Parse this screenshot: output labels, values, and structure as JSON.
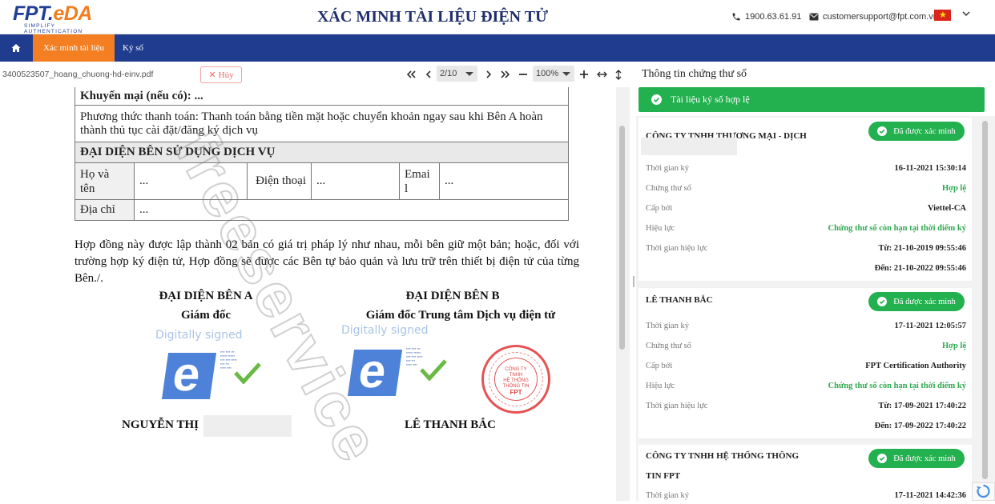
{
  "header": {
    "logo_text_a": "FPT.",
    "logo_text_b": "eDA",
    "logo_sub": "SIMPLIFY AUTHENTICATION",
    "title": "XÁC MINH TÀI LIỆU ĐIỆN TỬ",
    "phone": "1900.63.61.91",
    "email": "customersupport@fpt.com.vn"
  },
  "nav": {
    "tabs": [
      {
        "label": "Xác minh tài liệu"
      },
      {
        "label": "Ký số"
      }
    ]
  },
  "toolbar": {
    "filename": "3400523507_hoang_chuong-hd-einv.pdf",
    "cancel_label": "Hủy",
    "page": "2/10",
    "zoom": "100%"
  },
  "document": {
    "promo": "Khuyến mại (nếu có): ...",
    "payment": "Phương thức thanh toán: Thanh toán bằng tiền mặt hoặc chuyển khoản ngay sau khi Bên A hoàn thành thủ tục cài đặt/đăng ký dịch vụ",
    "rep_header": "ĐẠI DIỆN BÊN SỬ DỤNG DỊCH VỤ",
    "fullname_label_a": "Họ và",
    "fullname_label_b": "tên",
    "phone_label": "Điện thoại",
    "email_label_a": "Emai",
    "email_label_b": "l",
    "address_label": "Địa chỉ",
    "dots": "...",
    "para": "Hợp đồng này được lập thành 02 bản có giá trị pháp lý như nhau, mỗi bên giữ một bản; hoặc, đối với trường hợp ký điện tử, Hợp đồng sẽ được các Bên tự bảo quản và lưu trữ trên thiết bị điện tử của từng Bên./.",
    "party_a": "ĐẠI DIỆN BÊN A",
    "party_a_role": "Giám đốc",
    "party_b": "ĐẠI DIỆN BÊN B",
    "party_b_role": "Giám đốc Trung tâm Dịch vụ điện tử",
    "digitally_signed": "Digitally signed",
    "signer_a": "NGUYỄN THỊ",
    "signer_b": "LÊ THANH BẮC",
    "watermark": "freeservice"
  },
  "panel": {
    "title": "Thông tin chứng thư số",
    "valid_banner": "Tài liệu ký số hợp lệ",
    "badge_label": "Đã được xác minh",
    "labels": {
      "sign_time": "Thời gian ký",
      "cert": "Chứng thư số",
      "issuer": "Cấp bởi",
      "validity": "Hiệu lực",
      "validity_period": "Thời gian hiệu lực"
    },
    "cards": [
      {
        "name": "CÔNG TY TNHH THƯƠNG MẠI - DỊCH",
        "sign_time": "16-11-2021 15:30:14",
        "cert": "Hợp lệ",
        "issuer": "Viettel-CA",
        "validity": "Chứng thư số còn hạn tại thời điểm ký",
        "from": "Từ: 21-10-2019 09:55:46",
        "to": "Đến: 21-10-2022 09:55:46"
      },
      {
        "name": "LÊ THANH BẮC",
        "sign_time": "17-11-2021 12:05:57",
        "cert": "Hợp lệ",
        "issuer": "FPT Certification Authority",
        "validity": "Chứng thư số còn hạn tại thời điểm ký",
        "from": "Từ: 17-09-2021 17:40:22",
        "to": "Đến: 17-09-2022 17:40:22"
      },
      {
        "name_a": "CÔNG TY TNHH HỆ THỐNG THÔNG",
        "name_b": "TIN FPT",
        "sign_time": "17-11-2021 14:42:36"
      }
    ]
  },
  "stamp": {
    "line1": "CÔNG TY",
    "line2": "TNHH",
    "line3": "HỆ THỐNG",
    "line4": "THÔNG TIN",
    "line5": "FPT"
  },
  "colors": {
    "brand_blue": "#1f3c8f",
    "accent_orange": "#f37f22",
    "success_green": "#23b04f"
  }
}
